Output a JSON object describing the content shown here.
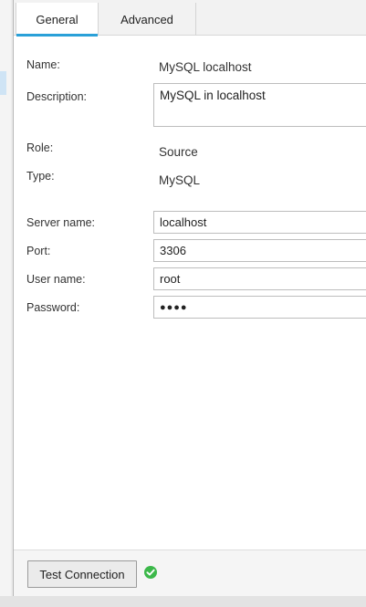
{
  "tabs": [
    {
      "label": "General",
      "active": true
    },
    {
      "label": "Advanced",
      "active": false
    }
  ],
  "form": {
    "name": {
      "label": "Name:",
      "value": "MySQL localhost"
    },
    "description": {
      "label": "Description:",
      "value": "MySQL in localhost"
    },
    "role": {
      "label": "Role:",
      "value": "Source"
    },
    "type": {
      "label": "Type:",
      "value": "MySQL"
    },
    "server_name": {
      "label": "Server name:",
      "value": "localhost"
    },
    "port": {
      "label": "Port:",
      "value": "3306"
    },
    "user_name": {
      "label": "User name:",
      "value": "root"
    },
    "password": {
      "label": "Password:",
      "value": "●●●●"
    }
  },
  "footer": {
    "test_button_label": "Test Connection",
    "status_icon": "check-circle-icon",
    "status_color": "#3cb84a"
  },
  "colors": {
    "accent": "#2aa0d8"
  }
}
